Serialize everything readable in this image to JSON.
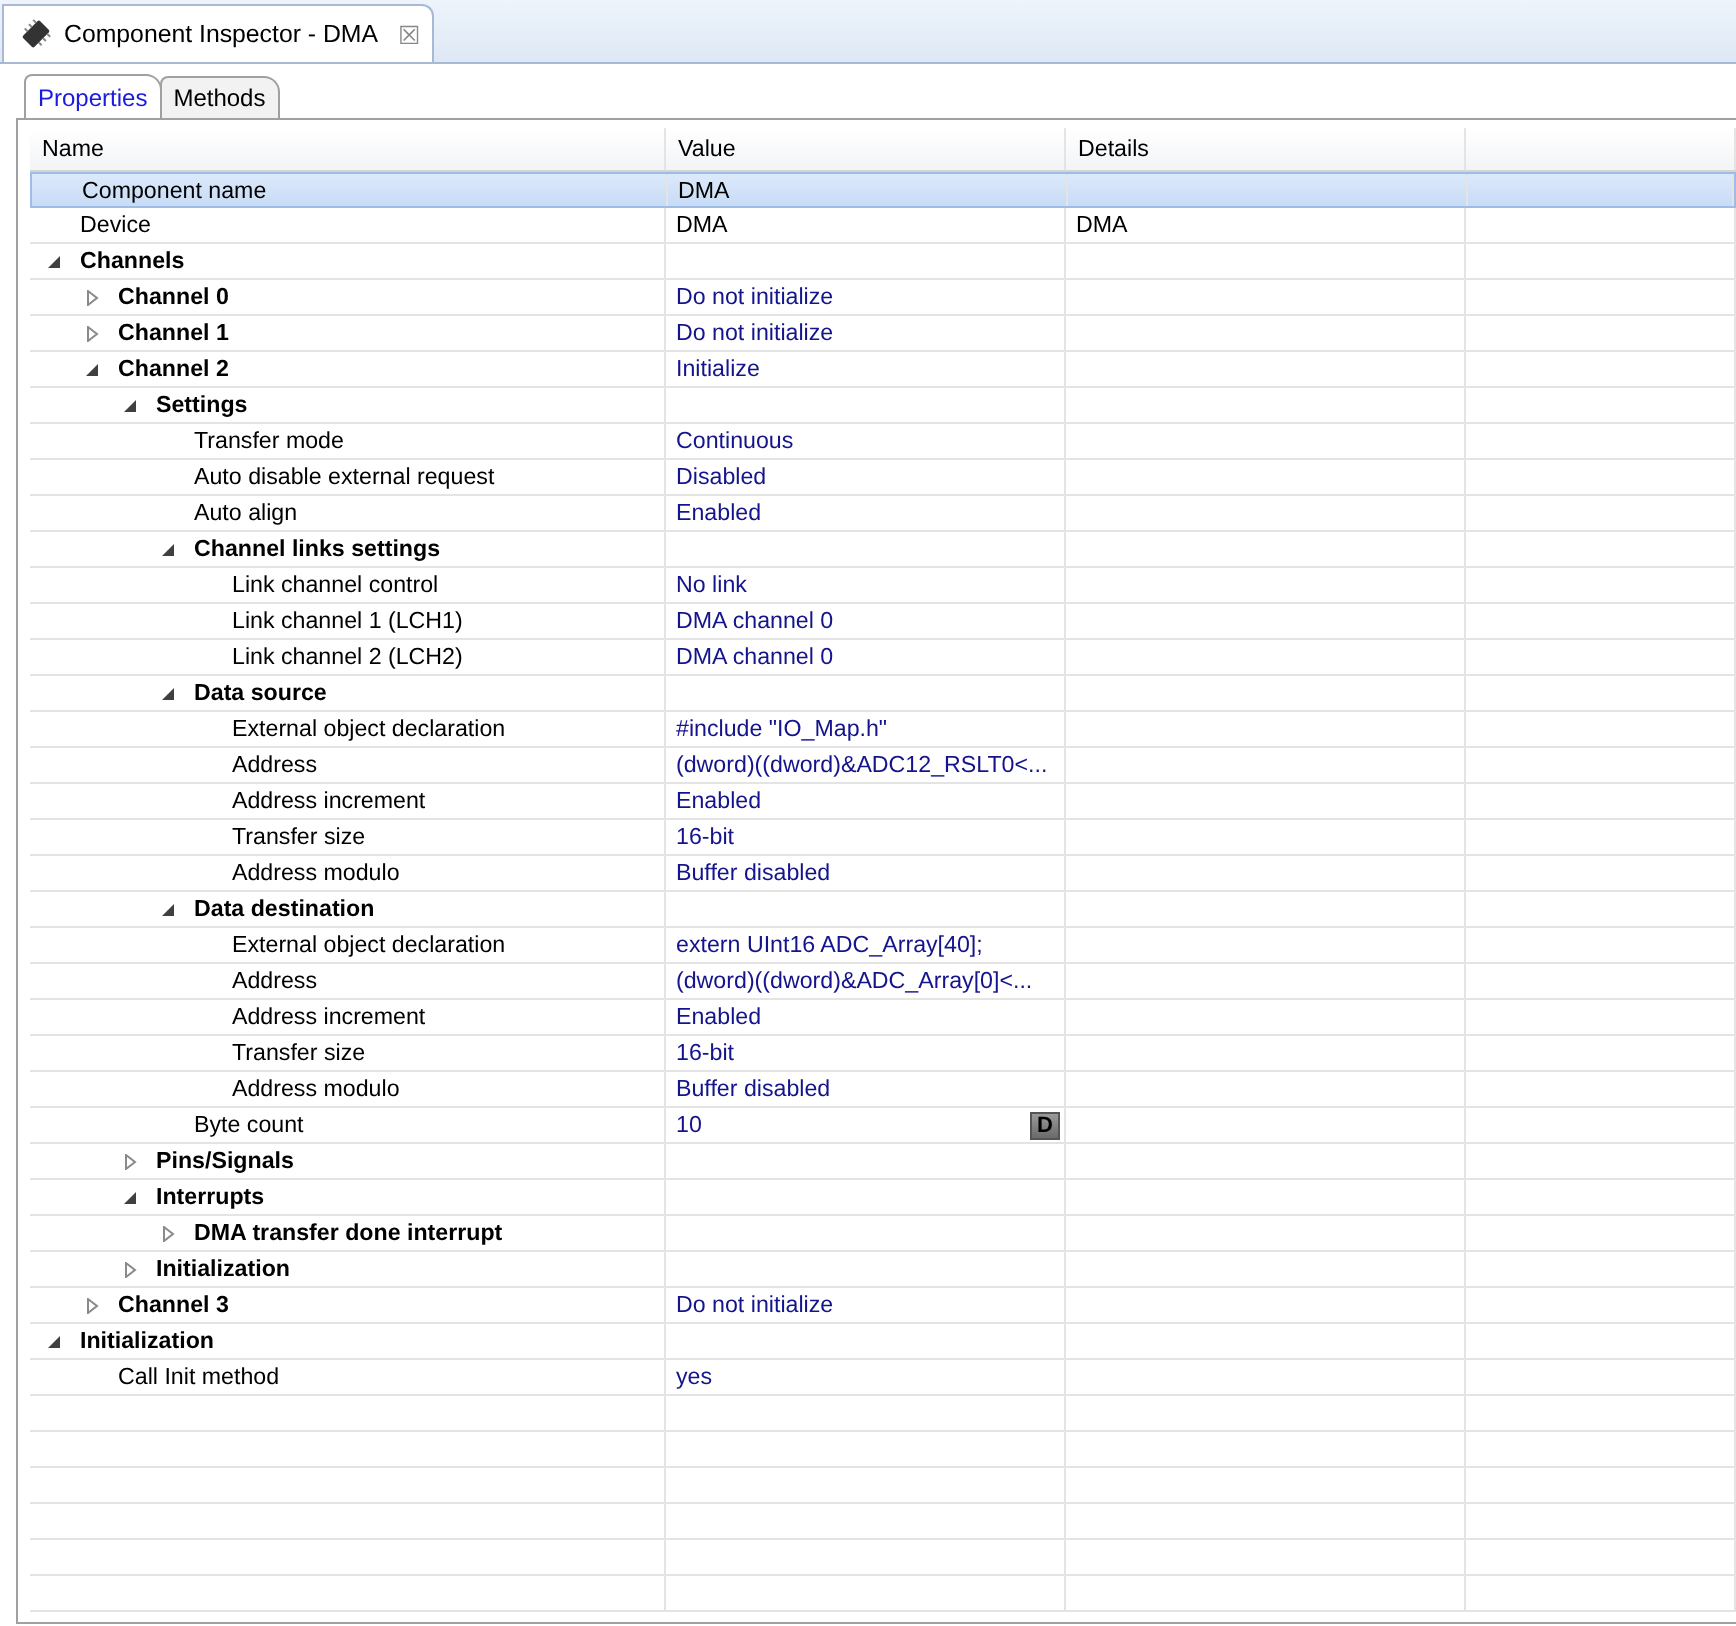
{
  "view_tab": {
    "title": "Component Inspector - DMA",
    "close": "☒"
  },
  "tabs": [
    {
      "label": "Properties",
      "selected": true
    },
    {
      "label": "Methods",
      "selected": false
    }
  ],
  "table": {
    "columns": [
      "Name",
      "Value",
      "Details"
    ],
    "rows": [
      {
        "kind": "info",
        "name": "Component name",
        "value": "DMA",
        "selected": true
      },
      {
        "kind": "info",
        "name": "Device",
        "value": "DMA",
        "details": "DMA",
        "selected": false
      },
      {
        "kind": "group",
        "name": "Channels",
        "expanded": true,
        "selected": false,
        "children": [
          {
            "kind": "group",
            "name": "Channel 0",
            "value": "Do not initialize",
            "expanded": false,
            "selected": false
          },
          {
            "kind": "group",
            "name": "Channel 1",
            "value": "Do not initialize",
            "expanded": false,
            "selected": false
          },
          {
            "kind": "group",
            "name": "Channel 2",
            "value": "Initialize",
            "expanded": true,
            "selected": false,
            "children": [
              {
                "kind": "group",
                "name": "Settings",
                "expanded": true,
                "selected": false,
                "children": [
                  {
                    "kind": "property",
                    "name": "Transfer mode",
                    "value": "Continuous",
                    "selected": false
                  },
                  {
                    "kind": "property",
                    "name": "Auto disable external request",
                    "value": "Disabled",
                    "selected": false
                  },
                  {
                    "kind": "property",
                    "name": "Auto align",
                    "value": "Enabled",
                    "selected": false
                  },
                  {
                    "kind": "group",
                    "name": "Channel links settings",
                    "expanded": true,
                    "selected": false,
                    "children": [
                      {
                        "kind": "property",
                        "name": "Link channel control",
                        "value": "No link",
                        "selected": false
                      },
                      {
                        "kind": "property",
                        "name": "Link channel 1 (LCH1)",
                        "value": "DMA channel 0",
                        "selected": false
                      },
                      {
                        "kind": "property",
                        "name": "Link channel 2 (LCH2)",
                        "value": "DMA channel 0",
                        "selected": false
                      }
                    ]
                  },
                  {
                    "kind": "group",
                    "name": "Data source",
                    "expanded": true,
                    "selected": false,
                    "children": [
                      {
                        "kind": "property",
                        "name": "External object declaration",
                        "value": "#include \"IO_Map.h\"",
                        "selected": false
                      },
                      {
                        "kind": "property",
                        "name": "Address",
                        "value": "(dword)((dword)&ADC12_RSLT0<...",
                        "selected": false
                      },
                      {
                        "kind": "property",
                        "name": "Address increment",
                        "value": "Enabled",
                        "selected": false
                      },
                      {
                        "kind": "property",
                        "name": "Transfer size",
                        "value": "16-bit",
                        "selected": false
                      },
                      {
                        "kind": "property",
                        "name": "Address modulo",
                        "value": "Buffer disabled",
                        "selected": false
                      }
                    ]
                  },
                  {
                    "kind": "group",
                    "name": "Data destination",
                    "expanded": true,
                    "selected": false,
                    "children": [
                      {
                        "kind": "property",
                        "name": "External object declaration",
                        "value": "extern UInt16 ADC_Array[40];",
                        "selected": false
                      },
                      {
                        "kind": "property",
                        "name": "Address",
                        "value": "(dword)((dword)&ADC_Array[0]<...",
                        "selected": false
                      },
                      {
                        "kind": "property",
                        "name": "Address increment",
                        "value": "Enabled",
                        "selected": false
                      },
                      {
                        "kind": "property",
                        "name": "Transfer size",
                        "value": "16-bit",
                        "selected": false
                      },
                      {
                        "kind": "property",
                        "name": "Address modulo",
                        "value": "Buffer disabled",
                        "selected": false
                      }
                    ]
                  },
                  {
                    "kind": "property",
                    "name": "Byte count",
                    "value": "10",
                    "button": "D",
                    "selected": false
                  }
                ]
              },
              {
                "kind": "group",
                "name": "Pins/Signals",
                "expanded": false,
                "selected": false
              },
              {
                "kind": "group",
                "name": "Interrupts",
                "expanded": true,
                "selected": false,
                "children": [
                  {
                    "kind": "group",
                    "name": "DMA transfer done interrupt",
                    "expanded": false,
                    "selected": false
                  }
                ]
              },
              {
                "kind": "group",
                "name": "Initialization",
                "expanded": false,
                "selected": false
              }
            ]
          },
          {
            "kind": "group",
            "name": "Channel 3",
            "value": "Do not initialize",
            "expanded": false,
            "selected": false
          }
        ]
      },
      {
        "kind": "group",
        "name": "Initialization",
        "expanded": true,
        "selected": false,
        "children": [
          {
            "kind": "property",
            "name": "Call Init method",
            "value": "yes",
            "selected": false
          }
        ]
      }
    ]
  }
}
